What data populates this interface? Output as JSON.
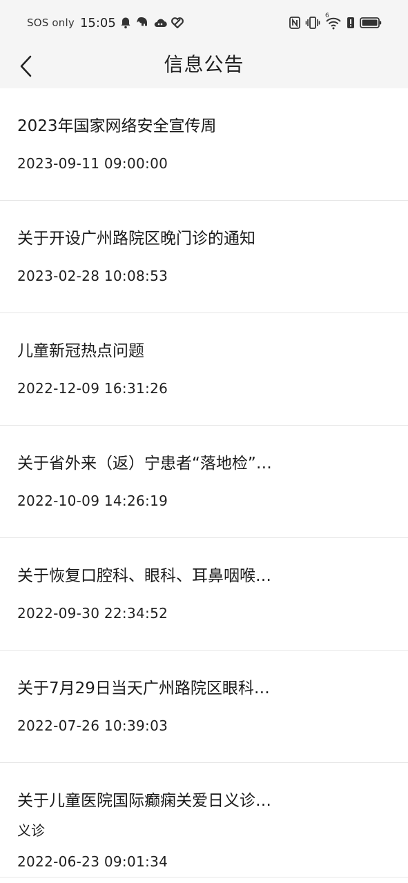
{
  "status_bar": {
    "carrier": "SOS only",
    "time": "15:05",
    "left_icons": [
      "bell-icon",
      "elephant-icon",
      "cloud-icon",
      "heart-icon"
    ],
    "right_icons": [
      "nfc-icon",
      "vibrate-icon",
      "wifi-icon",
      "alert-icon",
      "battery-icon"
    ],
    "wifi_label": "6"
  },
  "header": {
    "title": "信息公告",
    "back_icon": "chevron-left-icon"
  },
  "notices": [
    {
      "title": "2023年国家网络安全宣传周",
      "date": "2023-09-11 09:00:00"
    },
    {
      "title": "关于开设广州路院区晚门诊的通知",
      "date": "2023-02-28 10:08:53"
    },
    {
      "title": "儿童新冠热点问题",
      "date": "2022-12-09 16:31:26"
    },
    {
      "title": "关于省外来（返）宁患者“落地检”…",
      "date": "2022-10-09 14:26:19"
    },
    {
      "title": "关于恢复口腔科、眼科、耳鼻咽喉…",
      "date": "2022-09-30 22:34:52"
    },
    {
      "title": "关于7月29日当天广州路院区眼科…",
      "date": "2022-07-26 10:39:03"
    },
    {
      "title": "关于儿童医院国际癫痫关爱日义诊…",
      "subtitle": "义诊",
      "date": "2022-06-23 09:01:34"
    }
  ]
}
